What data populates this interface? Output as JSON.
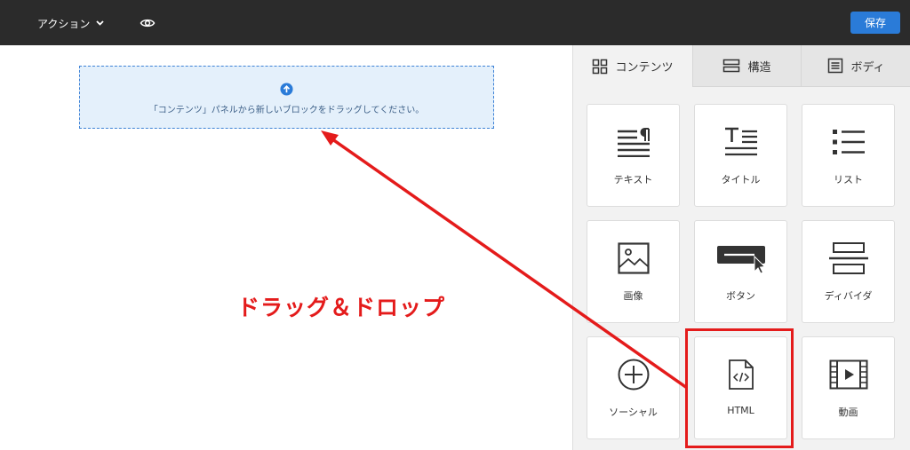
{
  "topbar": {
    "action_label": "アクション",
    "action_icon": "chevron-down-icon",
    "preview_icon": "eye-icon",
    "save_label": "保存"
  },
  "canvas": {
    "dropzone_icon": "arrow-up-circle-icon",
    "dropzone_text": "「コンテンツ」パネルから新しいブロックをドラッグしてください。",
    "annotation": "ドラッグ＆ドロップ"
  },
  "panel": {
    "tabs": [
      {
        "label": "コンテンツ",
        "icon": "grid-icon",
        "active": true
      },
      {
        "label": "構造",
        "icon": "structure-icon",
        "active": false
      },
      {
        "label": "ボディ",
        "icon": "body-icon",
        "active": false
      }
    ],
    "tiles": [
      {
        "label": "テキスト",
        "icon": "text-icon"
      },
      {
        "label": "タイトル",
        "icon": "title-icon"
      },
      {
        "label": "リスト",
        "icon": "list-icon"
      },
      {
        "label": "画像",
        "icon": "image-icon"
      },
      {
        "label": "ボタン",
        "icon": "button-icon"
      },
      {
        "label": "ディバイダ",
        "icon": "divider-icon"
      },
      {
        "label": "ソーシャル",
        "icon": "social-icon"
      },
      {
        "label": "HTML",
        "icon": "html-icon"
      },
      {
        "label": "動画",
        "icon": "video-icon"
      }
    ]
  },
  "colors": {
    "topbar": "#2b2b2b",
    "accent": "#2a7bd8",
    "annotation": "#e41b1b"
  }
}
